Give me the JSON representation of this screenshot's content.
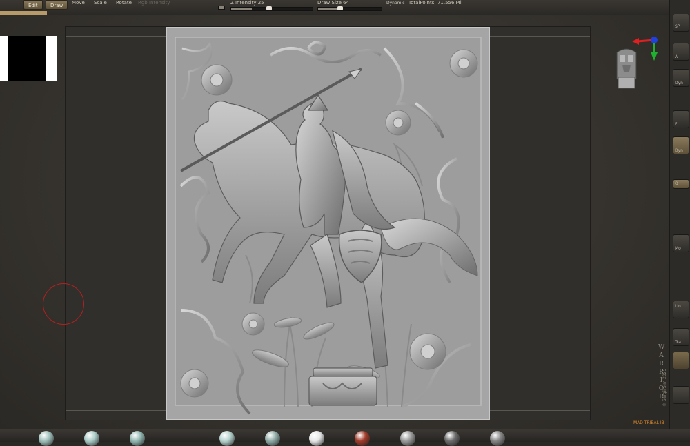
{
  "toolbar": {
    "edit_label": "Edit",
    "draw_label": "Draw",
    "move_label": "Move",
    "scale_label": "Scale",
    "rotate_label": "Rotate",
    "rgb_intensity_label": "Rgb Intensity",
    "z_intensity_label": "Z Intensity 25",
    "z_intensity_value": 25,
    "draw_size_label": "Draw Size 64",
    "draw_size_value": 64,
    "dynamic_label": "Dynamic",
    "total_points_label": "TotalPoints: 71.556 Mil"
  },
  "canvas": {
    "artwork_title": "W A R R I O R",
    "artist_credit": "© Sergii Sim 2025",
    "watermark_note": "MAD TRIBAL IB"
  },
  "right_shelf": {
    "items": [
      {
        "label": "SP"
      },
      {
        "label": "A"
      },
      {
        "label": "Dyn"
      },
      {
        "label": "Fl"
      },
      {
        "label": "Dyn"
      },
      {
        "label": "Q"
      },
      {
        "label": "Mo"
      },
      {
        "label": "Lin"
      },
      {
        "label": "Tra"
      }
    ]
  },
  "materials": [
    {
      "name": "skin-shade",
      "color": "#9fc0bb"
    },
    {
      "name": "matcap-teal",
      "color": "#a9cbc6"
    },
    {
      "name": "matcap-teal-2",
      "color": "#93b8b2"
    },
    {
      "name": "matcap-mint",
      "color": "#b6d3ce"
    },
    {
      "name": "matcap-grey",
      "color": "#8eaaa5"
    },
    {
      "name": "white-cavity",
      "color": "#e6e6e6"
    },
    {
      "name": "red-wax",
      "color": "#a23a2a"
    },
    {
      "name": "basic-grey",
      "color": "#9a9a9a"
    },
    {
      "name": "dark-grey",
      "color": "#6c6c6c"
    },
    {
      "name": "steel",
      "color": "#858585"
    }
  ],
  "colors": {
    "accent_gold": "#b69a6a",
    "brush_cursor": "#b32020",
    "gizmo_x": "#e02020",
    "gizmo_y": "#20b030",
    "gizmo_z": "#2040e0"
  }
}
